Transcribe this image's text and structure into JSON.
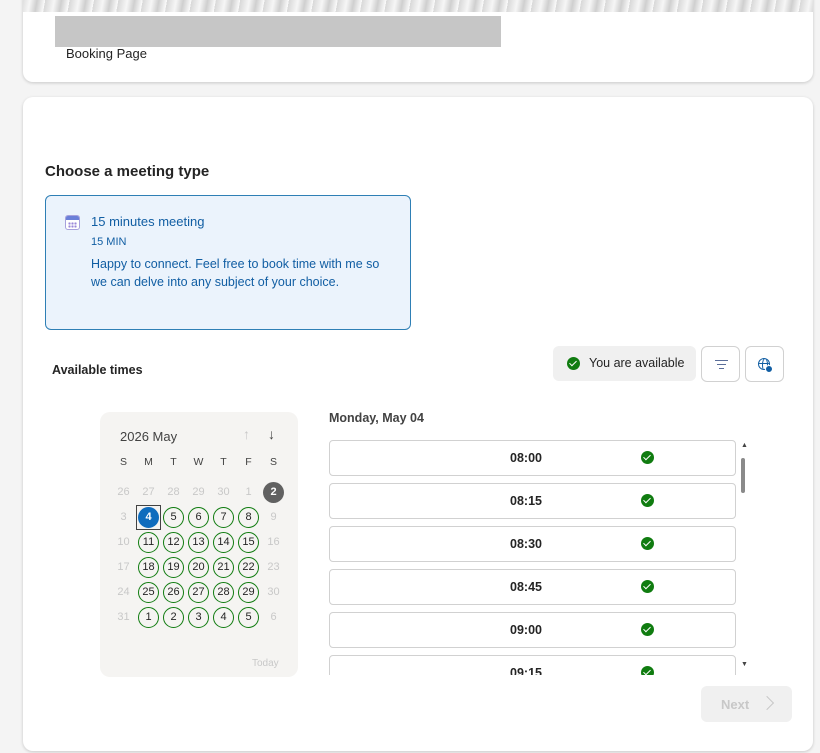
{
  "header": {
    "page_label": "Booking Page"
  },
  "main": {
    "title": "Choose a meeting type",
    "meeting": {
      "title": "15 minutes meeting",
      "duration": "15 MIN",
      "description": "Happy to connect. Feel free to book time with me so we can delve into any subject of your choice.",
      "icon": "calendar-icon"
    },
    "available_times_label": "Available times",
    "availability": {
      "text": "You are available",
      "icon": "check-circle-icon",
      "color": "#107c10"
    },
    "filter_icon": "filter-icon",
    "timezone_icon": "globe-icon"
  },
  "calendar": {
    "month_label": "2026 May",
    "weekdays": [
      "S",
      "M",
      "T",
      "W",
      "T",
      "F",
      "S"
    ],
    "weeks": [
      [
        {
          "d": "26",
          "s": "muted"
        },
        {
          "d": "27",
          "s": "muted"
        },
        {
          "d": "28",
          "s": "muted"
        },
        {
          "d": "29",
          "s": "muted"
        },
        {
          "d": "30",
          "s": "muted"
        },
        {
          "d": "1",
          "s": "muted"
        },
        {
          "d": "2",
          "s": "dark"
        }
      ],
      [
        {
          "d": "3",
          "s": "muted"
        },
        {
          "d": "4",
          "s": "selected"
        },
        {
          "d": "5",
          "s": "avail"
        },
        {
          "d": "6",
          "s": "avail"
        },
        {
          "d": "7",
          "s": "avail"
        },
        {
          "d": "8",
          "s": "avail"
        },
        {
          "d": "9",
          "s": "muted"
        }
      ],
      [
        {
          "d": "10",
          "s": "muted"
        },
        {
          "d": "11",
          "s": "avail"
        },
        {
          "d": "12",
          "s": "avail"
        },
        {
          "d": "13",
          "s": "avail"
        },
        {
          "d": "14",
          "s": "avail"
        },
        {
          "d": "15",
          "s": "avail"
        },
        {
          "d": "16",
          "s": "muted"
        }
      ],
      [
        {
          "d": "17",
          "s": "muted"
        },
        {
          "d": "18",
          "s": "avail"
        },
        {
          "d": "19",
          "s": "avail"
        },
        {
          "d": "20",
          "s": "avail"
        },
        {
          "d": "21",
          "s": "avail"
        },
        {
          "d": "22",
          "s": "avail"
        },
        {
          "d": "23",
          "s": "muted"
        }
      ],
      [
        {
          "d": "24",
          "s": "muted"
        },
        {
          "d": "25",
          "s": "avail"
        },
        {
          "d": "26",
          "s": "avail"
        },
        {
          "d": "27",
          "s": "avail"
        },
        {
          "d": "28",
          "s": "avail"
        },
        {
          "d": "29",
          "s": "avail"
        },
        {
          "d": "30",
          "s": "muted"
        }
      ],
      [
        {
          "d": "31",
          "s": "muted"
        },
        {
          "d": "1",
          "s": "avail"
        },
        {
          "d": "2",
          "s": "avail"
        },
        {
          "d": "3",
          "s": "avail"
        },
        {
          "d": "4",
          "s": "avail"
        },
        {
          "d": "5",
          "s": "avail"
        },
        {
          "d": "6",
          "s": "muted"
        }
      ]
    ],
    "today_label": "Today",
    "colors": {
      "selected": "#0f6cbd",
      "available": "#107c10",
      "dark": "#616161"
    }
  },
  "slots": {
    "date_label": "Monday, May 04",
    "times": [
      "08:00",
      "08:15",
      "08:30",
      "08:45",
      "09:00",
      "09:15"
    ]
  },
  "footer": {
    "next_label": "Next"
  }
}
